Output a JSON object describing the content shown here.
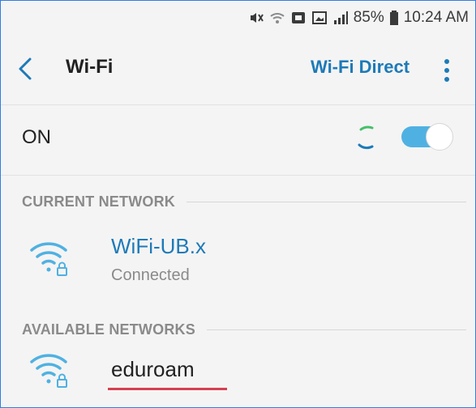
{
  "status_bar": {
    "battery_percent": "85%",
    "time": "10:24 AM",
    "icons": [
      "mute-vibrate-icon",
      "wifi-icon",
      "notification-icon",
      "gallery-icon",
      "signal-icon",
      "battery-icon"
    ]
  },
  "action_bar": {
    "title": "Wi-Fi",
    "wifi_direct_label": "Wi-Fi Direct",
    "back_icon": "chevron-left-icon",
    "more_icon": "more-vertical-icon"
  },
  "toggle": {
    "label": "ON",
    "state": "on",
    "scanning": true
  },
  "sections": {
    "current_header": "CURRENT NETWORK",
    "available_header": "AVAILABLE NETWORKS"
  },
  "current_network": {
    "name": "WiFi-UB.x",
    "status": "Connected",
    "secured": true
  },
  "available_networks": [
    {
      "name": "eduroam",
      "secured": true
    }
  ],
  "colors": {
    "accent": "#1d7ab8",
    "toggle_track": "#4fb1e2",
    "background": "#f4f4f4",
    "underline": "#d44152",
    "frame_border": "#2f7fe0"
  }
}
